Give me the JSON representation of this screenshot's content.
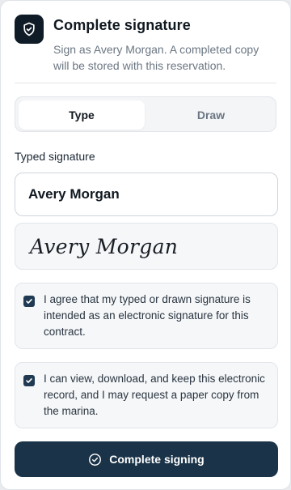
{
  "header": {
    "icon": "shield-check-icon",
    "title": "Complete signature",
    "subtitle": "Sign as Avery Morgan. A completed copy will be stored with this reservation."
  },
  "tabs": [
    {
      "label": "Type",
      "active": true
    },
    {
      "label": "Draw",
      "active": false
    }
  ],
  "signature": {
    "field_label": "Typed signature",
    "value": "Avery Morgan",
    "preview": "Avery Morgan"
  },
  "consents": [
    {
      "checked": true,
      "text": "I agree that my typed or drawn signature is intended as an electronic signature for this contract."
    },
    {
      "checked": true,
      "text": "I can view, download, and keep this electronic record, and I may request a paper copy from the marina."
    }
  ],
  "submit": {
    "icon": "check-circle-icon",
    "label": "Complete signing"
  },
  "colors": {
    "primary": "#1a3348",
    "badge": "#0f1b26",
    "muted_text": "#6b7682"
  }
}
